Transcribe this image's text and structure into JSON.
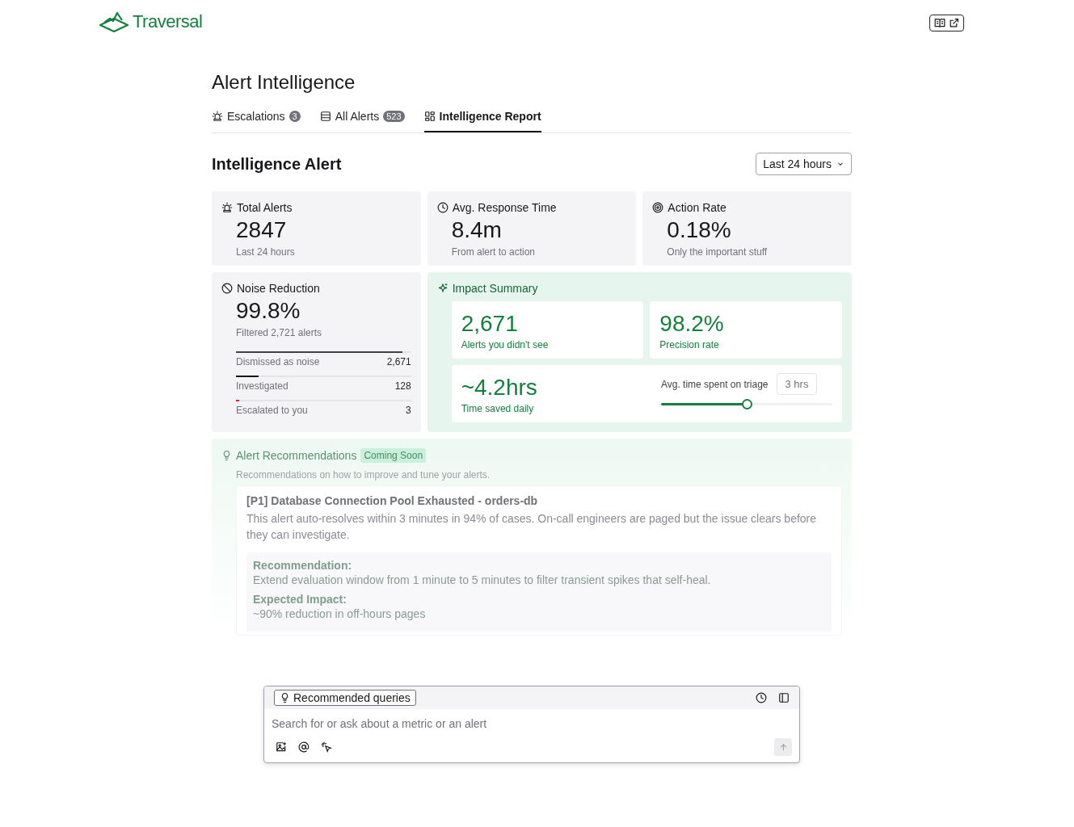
{
  "header": {
    "logo": "Traversal"
  },
  "page": {
    "title": "Alert Intelligence"
  },
  "tabs": [
    {
      "label": "Escalations",
      "count": "3",
      "selected": false
    },
    {
      "label": "All Alerts",
      "count": "523",
      "selected": false
    },
    {
      "label": "Intelligence Report",
      "selected": true
    }
  ],
  "section": {
    "title": "Intelligence Alert",
    "range": "Last 24 hours"
  },
  "stats": [
    {
      "title": "Total Alerts",
      "value": "2847",
      "caption": "Last 24 hours"
    },
    {
      "title": "Avg. Response Time",
      "value": "8.4m",
      "caption": "From alert to action"
    },
    {
      "title": "Action Rate",
      "value": "0.18%",
      "caption": "Only the important stuff"
    }
  ],
  "noise_reduction": {
    "title": "Noise Reduction",
    "value": "99.8%",
    "caption": "Filtered 2,721 alerts",
    "breakdown": [
      {
        "label": "Dismissed as noise",
        "count": "2,671",
        "level": 0.95,
        "color": "#3f3f46"
      },
      {
        "label": "Investigated",
        "count": "128",
        "level": 0.13,
        "color": "#111111"
      },
      {
        "label": "Escalated to you",
        "count": "3",
        "level": 0.02,
        "color": "#dc2626"
      }
    ]
  },
  "impact_summary": {
    "title": "Impact Summary",
    "metrics": [
      {
        "value": "2,671",
        "caption": "Alerts you didn't see"
      },
      {
        "value": "98.2%",
        "caption": "Precision rate"
      }
    ],
    "time_saved": {
      "value": "~4.2hrs",
      "caption": "Time saved daily"
    },
    "triage": {
      "label": "Avg. time spent on triage",
      "value": "3 hrs",
      "level": 0.5
    }
  },
  "recommendations": {
    "title": "Alert Recommendations",
    "badge": "Coming Soon",
    "subtitle": "Recommendations on how to improve and tune your alerts.",
    "items": [
      {
        "title": "[P1] Database Connection Pool Exhausted - orders-db",
        "description": "This alert auto-resolves within 3 minutes in 94% of cases. On-call engineers are paged but the issue clears before they can investigate.",
        "recommendation_label": "Recommendation:",
        "recommendation": "Extend evaluation window from 1 minute to 5 minutes to filter transient spikes that self-heal.",
        "impact_label": "Expected Impact:",
        "impact": "~90% reduction in off-hours pages"
      }
    ]
  },
  "query_box": {
    "chip": "Recommended queries",
    "placeholder": "Search for or ask about a metric or an alert"
  }
}
